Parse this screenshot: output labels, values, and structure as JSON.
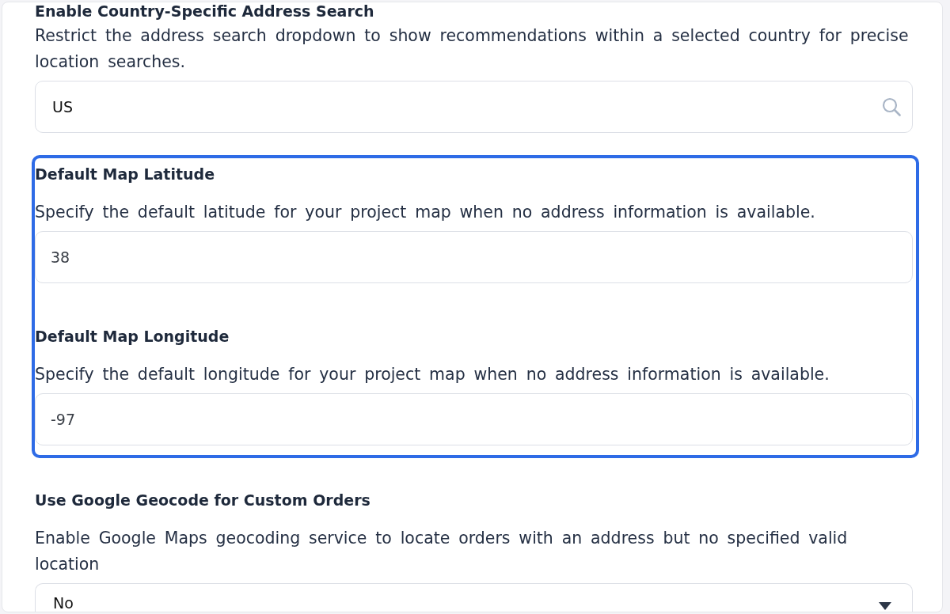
{
  "sections": [
    {
      "title": "Enable Country-Specific Address Search",
      "description": "Restrict the address search dropdown to show recommendations within a selected country for precise location searches.",
      "input": {
        "kind": "search",
        "value": "US"
      },
      "highlighted": false
    },
    {
      "title": "Default Map Latitude",
      "description": "Specify the default latitude for your project map when no address information is available.",
      "input": {
        "kind": "text",
        "value": "38"
      },
      "highlighted": true
    },
    {
      "title": "Default Map Longitude",
      "description": "Specify the default longitude for your project map when no address information is available.",
      "input": {
        "kind": "text",
        "value": "-97"
      },
      "highlighted": true
    },
    {
      "title": "Use Google Geocode for Custom Orders",
      "description": "Enable Google Maps geocoding service to locate orders with an address but no specified valid location",
      "input": {
        "kind": "select",
        "value": "No"
      },
      "highlighted": false
    }
  ]
}
